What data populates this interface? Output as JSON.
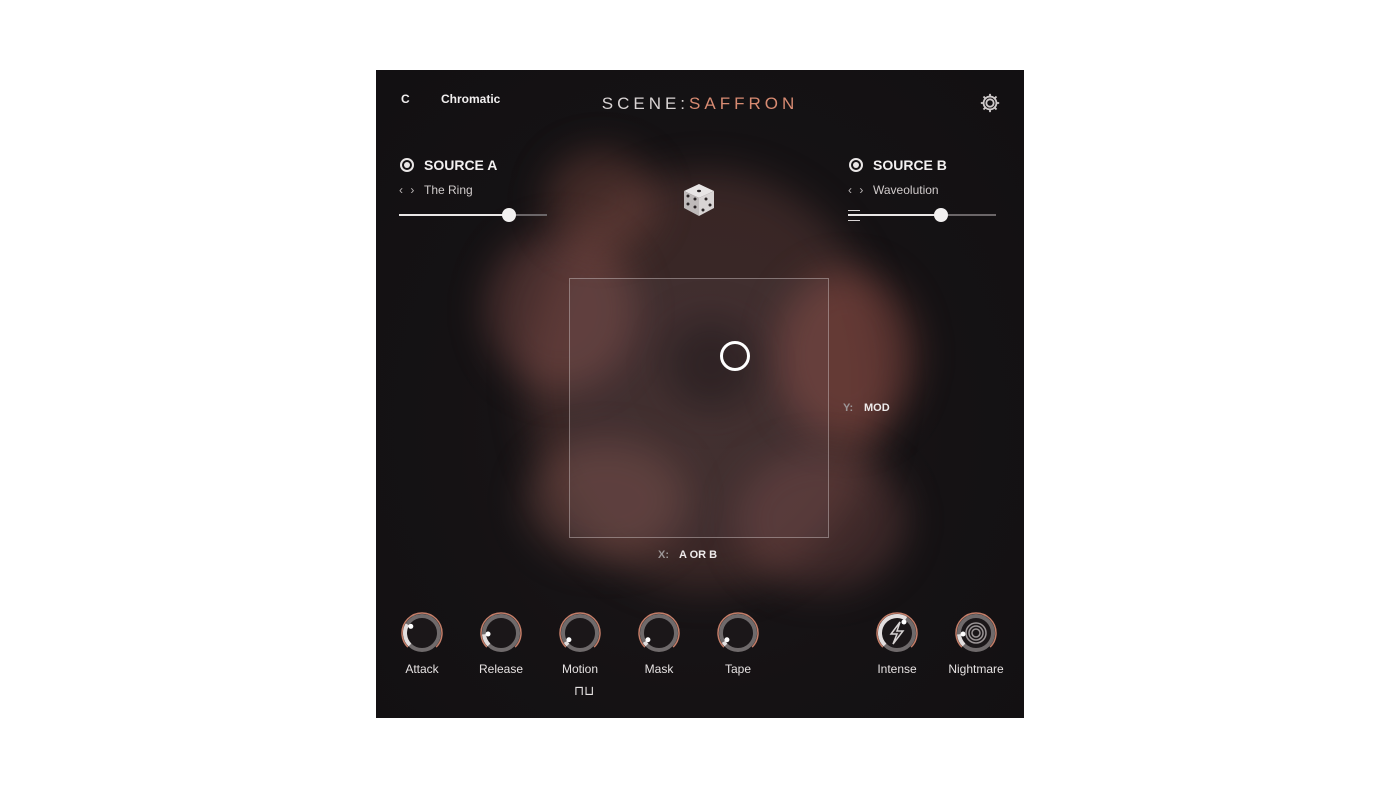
{
  "header": {
    "key": "C",
    "scale": "Chromatic",
    "title_prefix": "SCENE:",
    "title_accent": "SAFFRON"
  },
  "source_a": {
    "label": "SOURCE A",
    "nav": "‹ ›",
    "preset": "The Ring",
    "level": 0.74
  },
  "source_b": {
    "label": "SOURCE B",
    "nav": "‹ ›",
    "preset": "Waveolution",
    "level": 0.63
  },
  "xy_pad": {
    "x_key": "X:",
    "x_value": "A OR B",
    "y_key": "Y:",
    "y_value": "MOD",
    "handle_x": 0.64,
    "handle_y": 0.3
  },
  "knobs": [
    {
      "label": "Attack",
      "value": 0.28
    },
    {
      "label": "Release",
      "value": 0.15
    },
    {
      "label": "Motion",
      "value": 0.05
    },
    {
      "label": "Mask",
      "value": 0.05
    },
    {
      "label": "Tape",
      "value": 0.05
    }
  ],
  "fx_knobs": [
    {
      "label": "Intense",
      "value": 0.62,
      "icon": "bolt-icon"
    },
    {
      "label": "Nightmare",
      "value": 0.15,
      "icon": "spiral-icon"
    }
  ],
  "motion_glyph": "⊓⊔",
  "colors": {
    "accent": "#d88b72",
    "background": "#151214",
    "text": "#e9e6e6"
  }
}
